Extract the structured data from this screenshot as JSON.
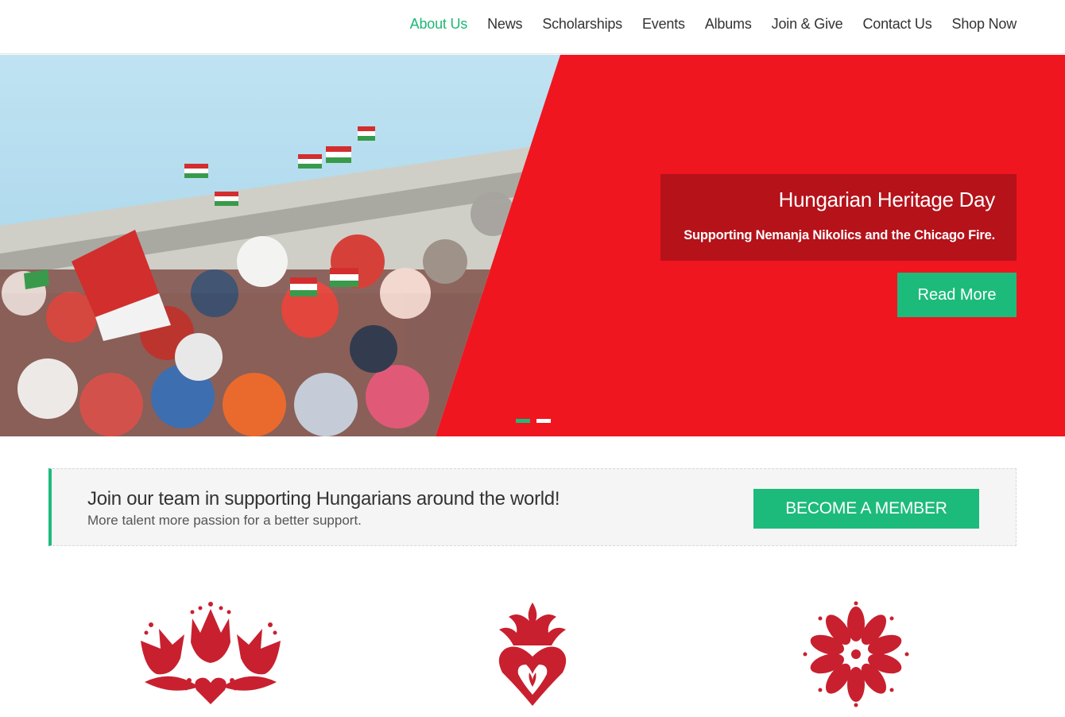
{
  "nav": {
    "items": [
      {
        "label": "About Us",
        "active": true
      },
      {
        "label": "News"
      },
      {
        "label": "Scholarships"
      },
      {
        "label": "Events"
      },
      {
        "label": "Albums"
      },
      {
        "label": "Join & Give"
      },
      {
        "label": "Contact Us"
      },
      {
        "label": "Shop Now"
      }
    ]
  },
  "hero": {
    "title": "Hungarian Heritage Day",
    "subtitle": "Supporting Nemanja Nikolics and the Chicago Fire.",
    "button_label": "Read More",
    "slides_total": 2,
    "active_slide": 1,
    "image_description_icon": "stadium-crowd-photo"
  },
  "cta": {
    "title": "Join our team in supporting Hungarians around the world!",
    "subtitle": "More talent more passion for a better support.",
    "button_label": "BECOME A MEMBER"
  },
  "features": [
    {
      "icon": "tulip-folk-motif-icon"
    },
    {
      "icon": "heart-flame-folk-motif-icon"
    },
    {
      "icon": "flower-folk-motif-icon"
    }
  ],
  "colors": {
    "accent_green": "#1dbb7b",
    "hero_red": "#f0161f",
    "caption_red": "#b5121a",
    "motif_red": "#c8202f"
  }
}
